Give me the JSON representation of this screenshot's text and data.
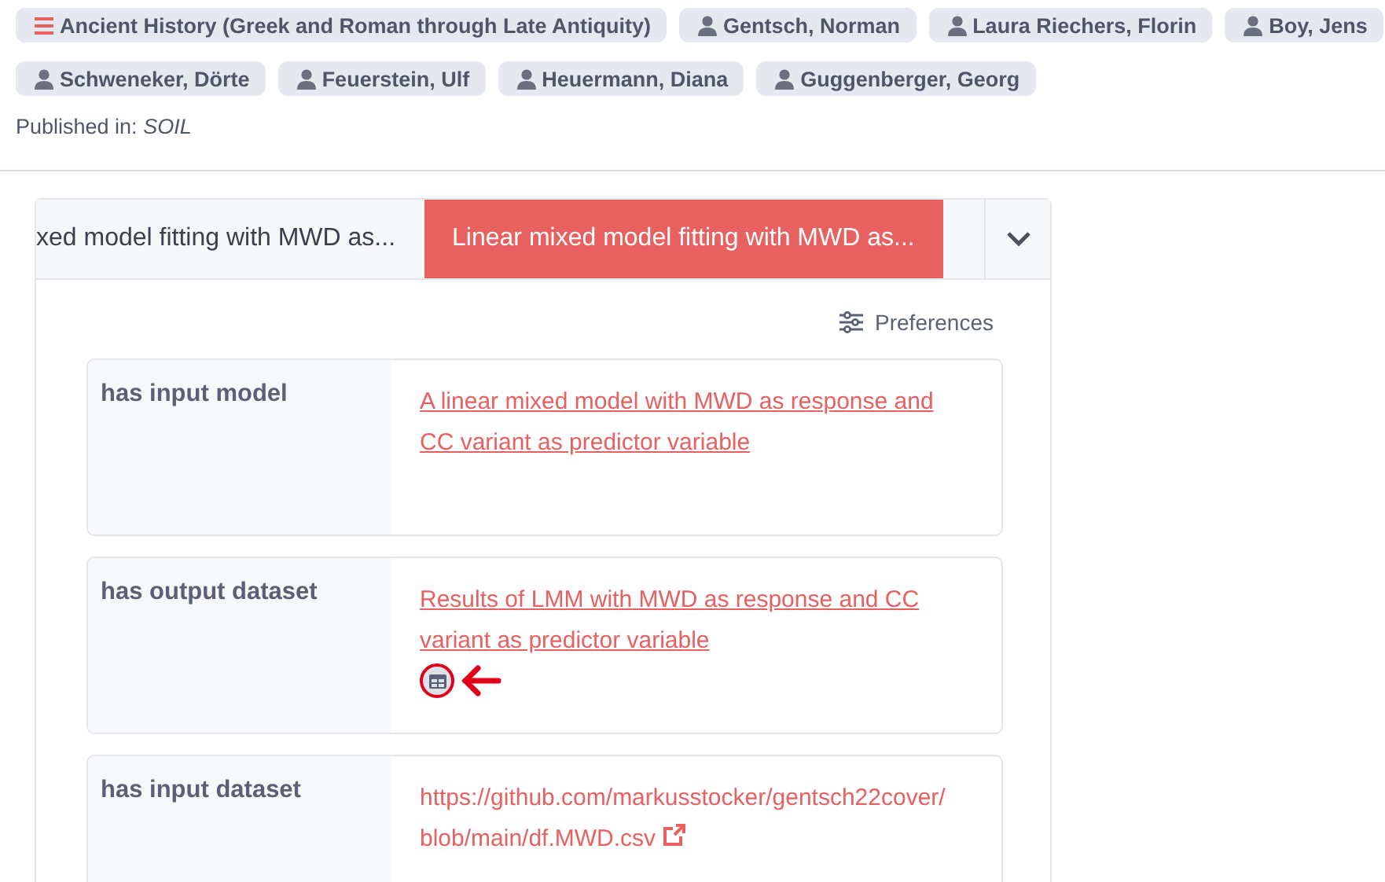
{
  "chip_rows": [
    [
      {
        "kind": "field",
        "label": "Ancient History (Greek and Roman through Late Antiquity)"
      },
      {
        "kind": "person",
        "label": "Gentsch, Norman"
      },
      {
        "kind": "person",
        "label": "Laura Riechers, Florin"
      },
      {
        "kind": "person",
        "label": "Boy, Jens"
      }
    ],
    [
      {
        "kind": "person",
        "label": "Schweneker, Dörte"
      },
      {
        "kind": "person",
        "label": "Feuerstein, Ulf"
      },
      {
        "kind": "person",
        "label": "Heuermann, Diana"
      },
      {
        "kind": "person",
        "label": "Guggenberger, Georg"
      }
    ]
  ],
  "published": {
    "label": "Published in:",
    "venue": "SOIL"
  },
  "tabs": [
    {
      "label": "xed model fitting with MWD as...",
      "selected": false
    },
    {
      "label": "Linear mixed model fitting with MWD as...",
      "selected": true
    }
  ],
  "preferences": "Preferences",
  "rows": [
    {
      "property": "has input model",
      "kind": "link",
      "value": "A linear mixed model with MWD as response and CC variant as predictor variable",
      "table_view": false,
      "annotated": false
    },
    {
      "property": "has output dataset",
      "kind": "link",
      "value": "Results of LMM with MWD as response and CC variant as predictor variable",
      "table_view": true,
      "annotated": true
    },
    {
      "property": "has input dataset",
      "kind": "url",
      "value": "https://github.com/markusstocker/gentsch22cover/blob/main/df.MWD.csv",
      "table_view": false,
      "annotated": false
    }
  ]
}
